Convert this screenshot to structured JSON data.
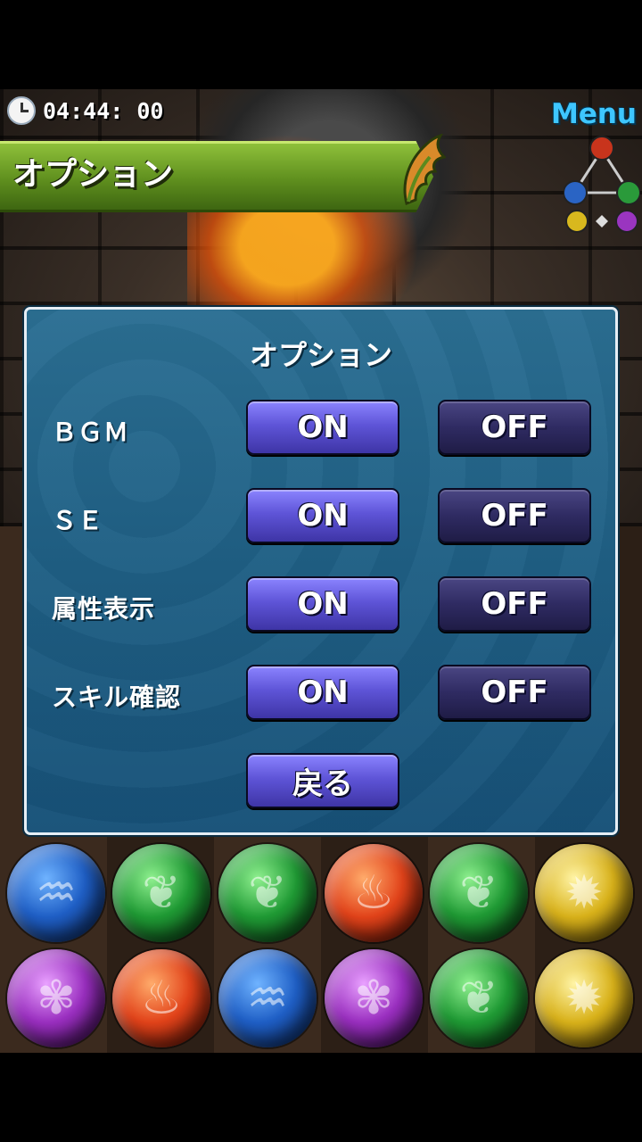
{
  "hud": {
    "time": "04:44: 00",
    "menu_label": "Menu"
  },
  "banner": {
    "title": "オプション"
  },
  "dialog": {
    "title": "オプション",
    "rows": [
      {
        "label": "ＢＧＭ",
        "on_label": "ON",
        "off_label": "OFF"
      },
      {
        "label": "ＳＥ",
        "on_label": "ON",
        "off_label": "OFF"
      },
      {
        "label": "属性表示",
        "on_label": "ON",
        "off_label": "OFF"
      },
      {
        "label": "スキル確認",
        "on_label": "ON",
        "off_label": "OFF"
      }
    ],
    "back_label": "戻る"
  },
  "board": {
    "visible_rows": [
      [
        "blue",
        "green",
        "green",
        "red",
        "green",
        "yellow"
      ],
      [
        "purple",
        "red",
        "blue",
        "purple",
        "green",
        "yellow"
      ]
    ]
  },
  "colors": {
    "dialog_bg": "#1f5f84",
    "on_button": "#5f55d8",
    "off_button": "#2f2b62",
    "banner": "#5f8f1e",
    "menu_text": "#3ec6ff"
  }
}
